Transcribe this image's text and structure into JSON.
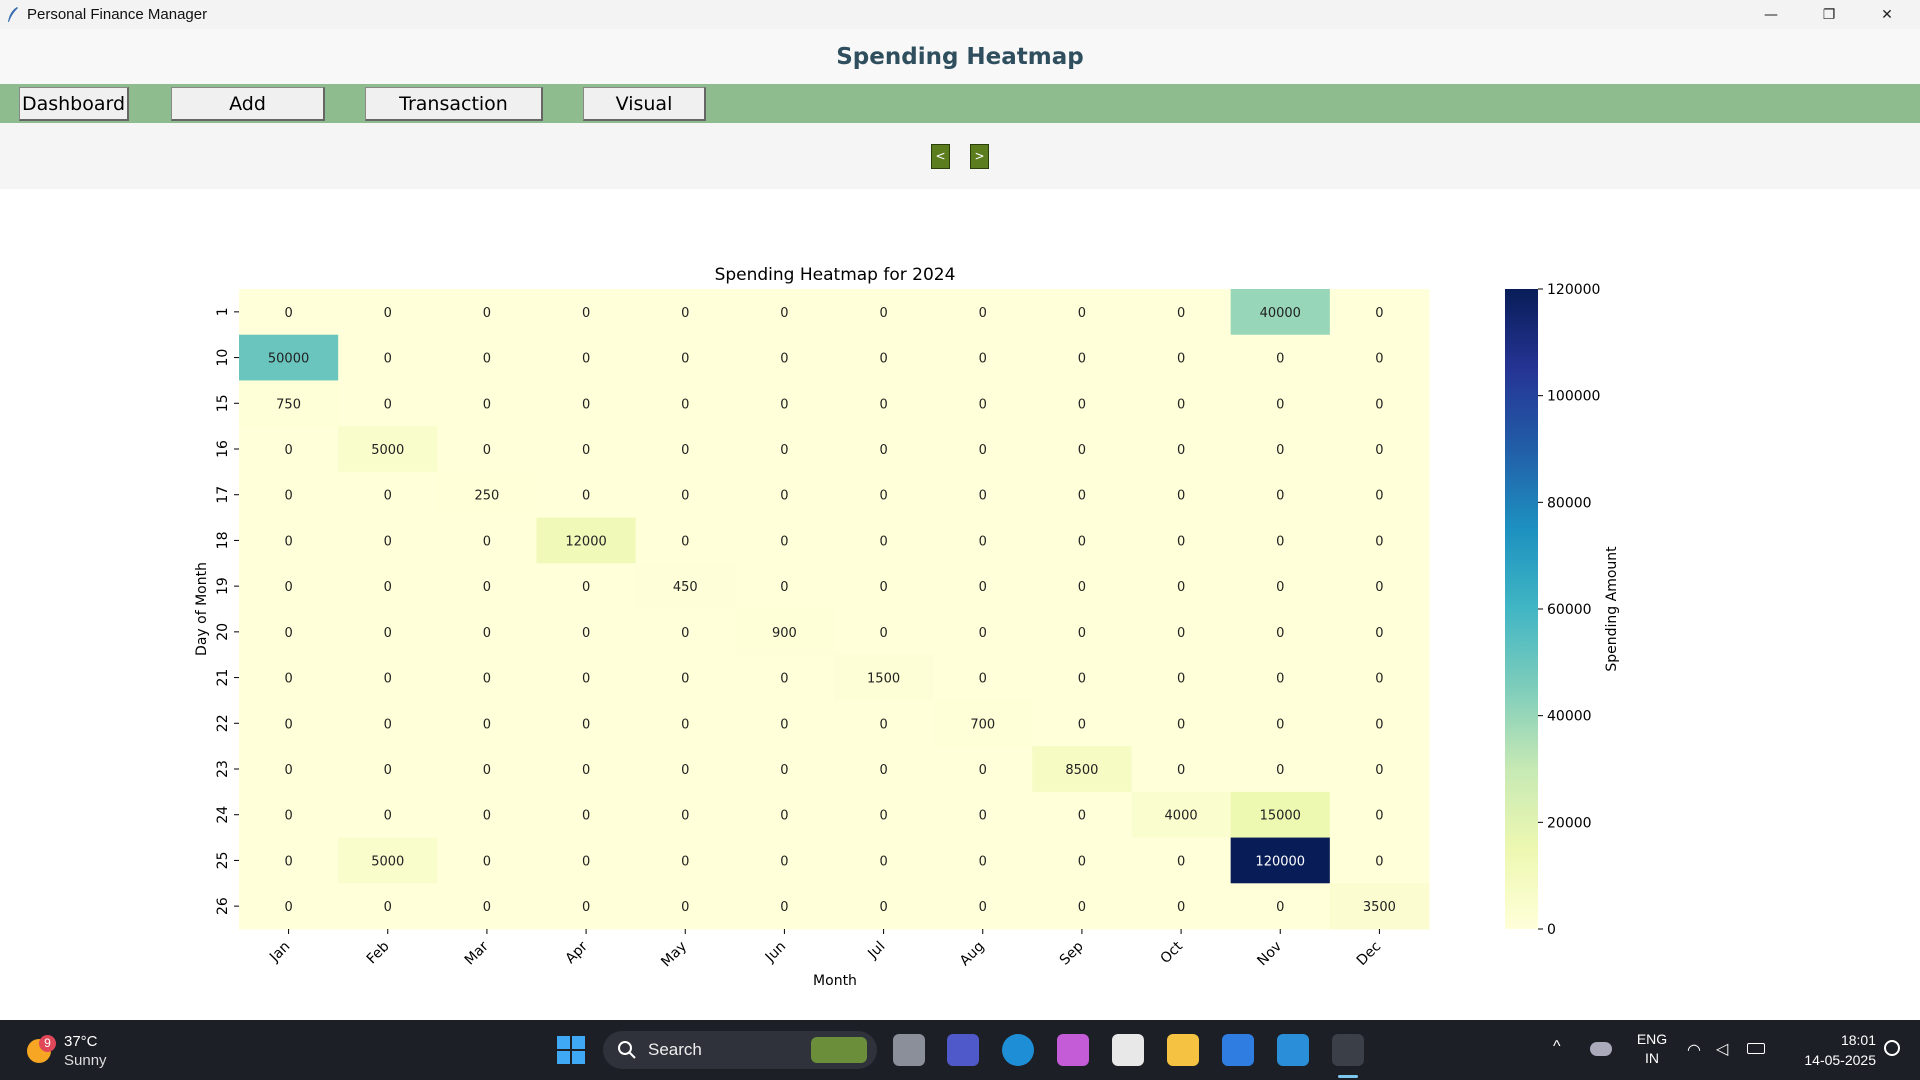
{
  "window": {
    "title": "Personal Finance Manager",
    "minimize_glyph": "—",
    "restore_glyph": "❐",
    "close_glyph": "✕"
  },
  "header": {
    "title": "Spending Heatmap"
  },
  "nav": {
    "buttons": [
      "Dashboard",
      "Add Transaction",
      "Transaction History",
      "Visual report"
    ]
  },
  "pager": {
    "prev": "<",
    "next": ">"
  },
  "chart_data": {
    "type": "heatmap",
    "title": "Spending Heatmap for 2024",
    "xlabel": "Month",
    "ylabel": "Day of Month",
    "x_categories": [
      "Jan",
      "Feb",
      "Mar",
      "Apr",
      "May",
      "Jun",
      "Jul",
      "Aug",
      "Sep",
      "Oct",
      "Nov",
      "Dec"
    ],
    "y_categories": [
      "1",
      "10",
      "15",
      "16",
      "17",
      "18",
      "19",
      "20",
      "21",
      "22",
      "23",
      "24",
      "25",
      "26"
    ],
    "values": [
      [
        0,
        0,
        0,
        0,
        0,
        0,
        0,
        0,
        0,
        0,
        40000,
        0
      ],
      [
        50000,
        0,
        0,
        0,
        0,
        0,
        0,
        0,
        0,
        0,
        0,
        0
      ],
      [
        750,
        0,
        0,
        0,
        0,
        0,
        0,
        0,
        0,
        0,
        0,
        0
      ],
      [
        0,
        5000,
        0,
        0,
        0,
        0,
        0,
        0,
        0,
        0,
        0,
        0
      ],
      [
        0,
        0,
        250,
        0,
        0,
        0,
        0,
        0,
        0,
        0,
        0,
        0
      ],
      [
        0,
        0,
        0,
        12000,
        0,
        0,
        0,
        0,
        0,
        0,
        0,
        0
      ],
      [
        0,
        0,
        0,
        0,
        450,
        0,
        0,
        0,
        0,
        0,
        0,
        0
      ],
      [
        0,
        0,
        0,
        0,
        0,
        900,
        0,
        0,
        0,
        0,
        0,
        0
      ],
      [
        0,
        0,
        0,
        0,
        0,
        0,
        1500,
        0,
        0,
        0,
        0,
        0
      ],
      [
        0,
        0,
        0,
        0,
        0,
        0,
        0,
        700,
        0,
        0,
        0,
        0
      ],
      [
        0,
        0,
        0,
        0,
        0,
        0,
        0,
        0,
        8500,
        0,
        0,
        0
      ],
      [
        0,
        0,
        0,
        0,
        0,
        0,
        0,
        0,
        0,
        4000,
        15000,
        0
      ],
      [
        0,
        5000,
        0,
        0,
        0,
        0,
        0,
        0,
        0,
        0,
        120000,
        0
      ],
      [
        0,
        0,
        0,
        0,
        0,
        0,
        0,
        0,
        0,
        0,
        0,
        3500
      ]
    ],
    "colorbar": {
      "label": "Spending Amount",
      "range": [
        0,
        120000
      ],
      "ticks": [
        0,
        20000,
        40000,
        60000,
        80000,
        100000,
        120000
      ],
      "colormap": "YlGnBu"
    }
  },
  "taskbar": {
    "weather": {
      "temp": "37°C",
      "condition": "Sunny",
      "badge": "9"
    },
    "search_label": "Search",
    "language": {
      "line1": "ENG",
      "line2": "IN"
    },
    "clock": {
      "time": "18:01",
      "date": "14-05-2025"
    },
    "apps": [
      "windows-start-icon",
      "task-view-icon",
      "teams-icon",
      "edge-icon",
      "copilot-icon",
      "store-icon",
      "file-explorer-icon",
      "todo-icon",
      "vscode-icon",
      "python-feather-icon"
    ]
  }
}
